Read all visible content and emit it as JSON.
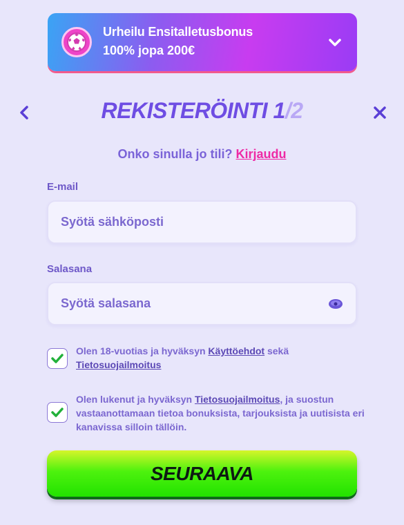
{
  "bonus": {
    "title": "Urheilu Ensitalletusbonus",
    "amount": "100% jopa 200€"
  },
  "header": {
    "title": "REKISTERÖINTI 1",
    "separator": "/",
    "step_total": "2"
  },
  "login_prompt": {
    "text": "Onko sinulla jo tili?",
    "link": "Kirjaudu"
  },
  "email": {
    "label": "E-mail",
    "placeholder": "Syötä sähköposti",
    "value": ""
  },
  "password": {
    "label": "Salasana",
    "placeholder": "Syötä salasana",
    "value": ""
  },
  "consent_terms": {
    "checked": true,
    "text_before": "Olen 18-vuotias ja hyväksyn ",
    "link_terms": "Käyttöehdot",
    "text_middle": " sekä",
    "link_privacy": "Tietosuojailmoitus"
  },
  "consent_marketing": {
    "checked": true,
    "text_before": "Olen lukenut ja hyväksyn ",
    "link_privacy": "Tietosuojailmoitus",
    "text_after": ", ja suostun vastaanottamaan tietoa bonuksista, tarjouksista ja uutisista eri kanavissa silloin tällöin."
  },
  "next_button": {
    "label": "SEURAAVA"
  },
  "colors": {
    "accent": "#6e4de3",
    "link_pink": "#ee2aa5",
    "button_green": "#22e200",
    "background": "#e8e6fb"
  },
  "icons": {
    "bonus": "soccer-ball-icon",
    "bonus_toggle": "chevron-down-icon",
    "back": "chevron-left-icon",
    "close": "close-icon",
    "password_toggle": "eye-icon",
    "checkbox": "checkmark-icon"
  }
}
